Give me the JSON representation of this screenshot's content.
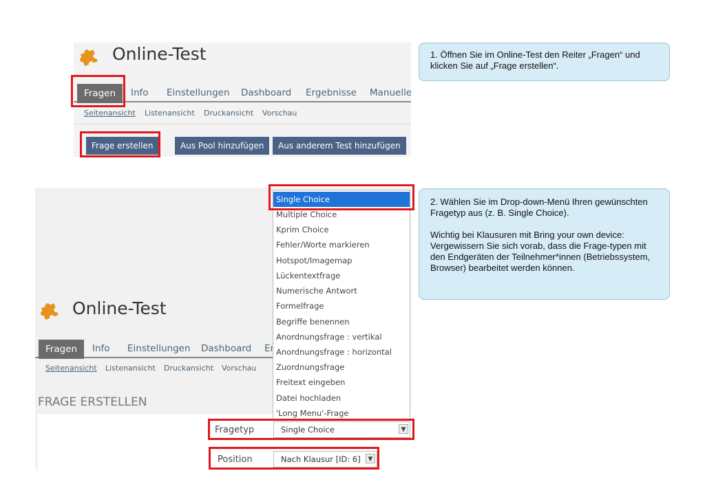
{
  "panel1": {
    "title": "Online-Test",
    "tabs": [
      "Fragen",
      "Info",
      "Einstellungen",
      "Dashboard",
      "Ergebnisse",
      "Manuelle"
    ],
    "subnav": [
      "Seitenansicht",
      "Listenansicht",
      "Druckansicht",
      "Vorschau"
    ],
    "buttons": [
      "Frage erstellen",
      "Aus Pool hinzufügen",
      "Aus anderem Test hinzufügen"
    ]
  },
  "callout1": {
    "text": "1. Öffnen Sie im Online-Test den Reiter „Fragen“ und klicken Sie auf „Frage erstellen“."
  },
  "callout2": {
    "text1": "2. Wählen Sie im Drop-down-Menü Ihren gewünschten Fragetyp aus (z. B. Single Choice).",
    "text2": "Wichtig bei Klausuren mit Bring your own device: Vergewissern Sie sich vorab, dass die Frage-typen mit den Endgeräten der Teilnehmer*innen (Betriebssystem, Browser) bearbeitet werden können."
  },
  "panel2": {
    "title": "Online-Test",
    "tabs": [
      "Fragen",
      "Info",
      "Einstellungen",
      "Dashboard",
      "Er"
    ],
    "subnav": [
      "Seitenansicht",
      "Listenansicht",
      "Druckansicht",
      "Vorschau"
    ],
    "section_heading": "FRAGE ERSTELLEN",
    "fragetyp_label": "Fragetyp",
    "fragetyp_value": "Single Choice",
    "position_label": "Position",
    "position_value": "Nach Klausur [ID: 6]",
    "dropdown_options": [
      "Single Choice",
      "Multiple Choice",
      "Kprim Choice",
      "Fehler/Worte markieren",
      "Hotspot/Imagemap",
      "Lückentextfrage",
      "Numerische Antwort",
      "Formelfrage",
      "Begriffe benennen",
      "Anordnungsfrage : vertikal",
      "Anordnungsfrage : horizontal",
      "Zuordnungsfrage",
      "Freitext eingeben",
      "Datei hochladen",
      "'Long Menu'-Frage"
    ]
  },
  "colors": {
    "accent_red": "#e1161c",
    "button_blue": "#4a6286",
    "selected_blue": "#1f73d9",
    "logo_orange": "#e8911c",
    "callout_bg": "#d6ecf7"
  },
  "icons": {
    "logo": "puzzle-piece-icon",
    "select_arrow": "chevron-down-icon"
  }
}
